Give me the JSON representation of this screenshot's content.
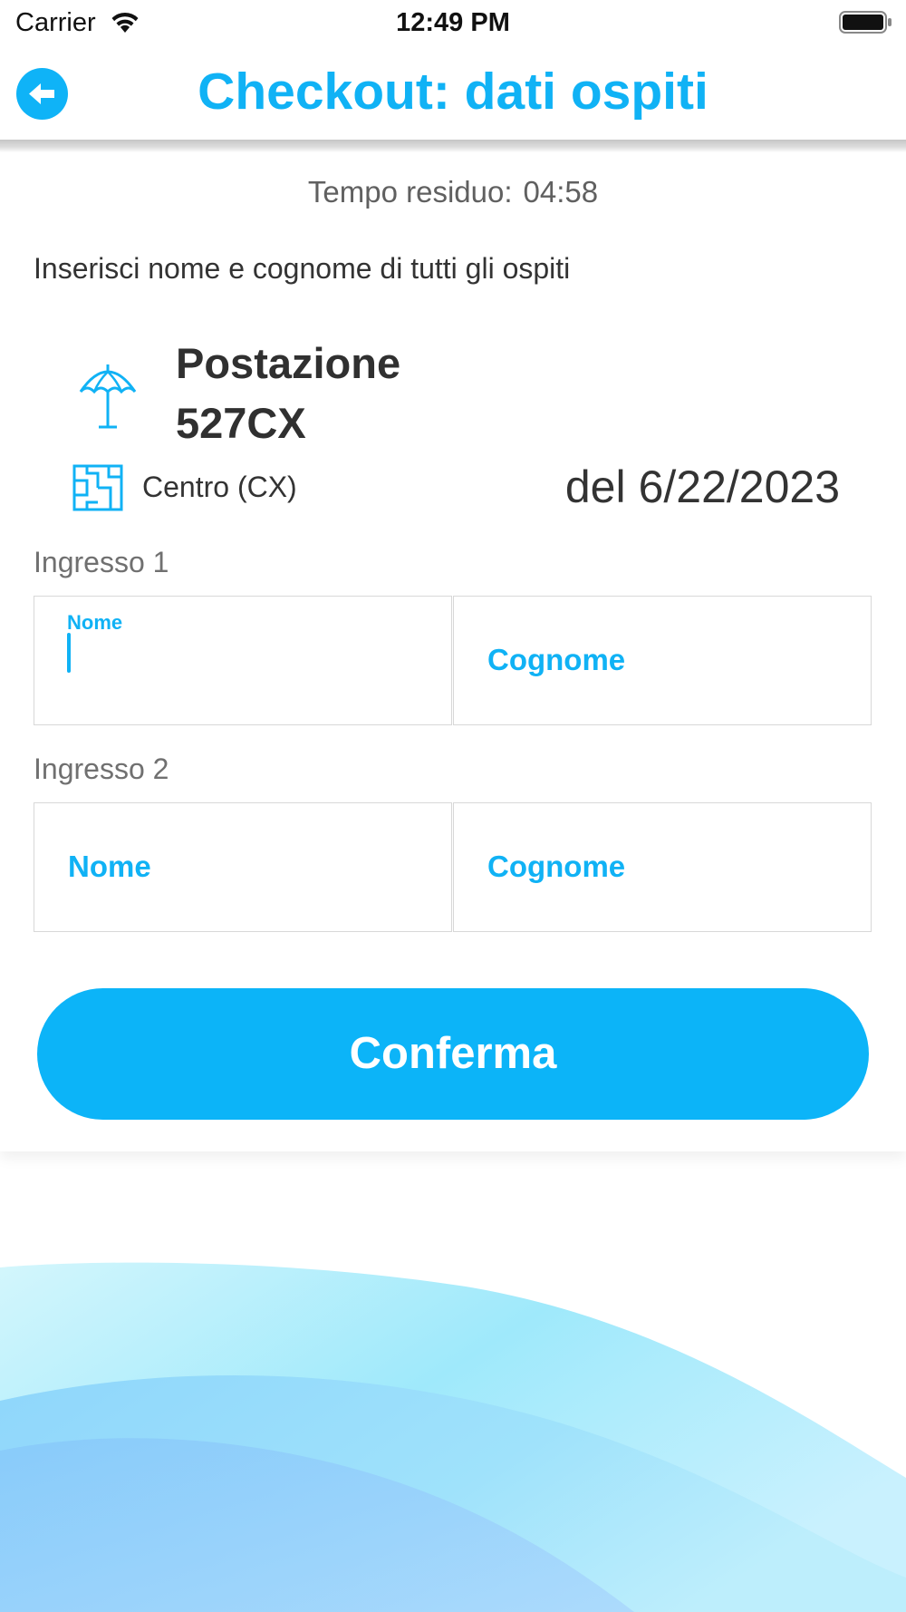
{
  "status_bar": {
    "carrier": "Carrier",
    "time": "12:49 PM"
  },
  "header": {
    "title": "Checkout: dati ospiti",
    "back_icon": "arrow-left-circle-icon"
  },
  "timer": {
    "label": "Tempo residuo:",
    "value": "04:58"
  },
  "instructions": "Inserisci nome e cognome di tutti gli ospiti",
  "station": {
    "title_line1": "Postazione",
    "title_line2": "527CX",
    "icon": "beach-umbrella-icon"
  },
  "zone": {
    "label": "Centro (CX)",
    "icon": "map-icon"
  },
  "date": {
    "prefix": "del",
    "value": "6/22/2023"
  },
  "entries": [
    {
      "label": "Ingresso 1",
      "first_name_placeholder": "Nome",
      "last_name_placeholder": "Cognome",
      "first_name_value": "",
      "last_name_value": ""
    },
    {
      "label": "Ingresso 2",
      "first_name_placeholder": "Nome",
      "last_name_placeholder": "Cognome",
      "first_name_value": "",
      "last_name_value": ""
    }
  ],
  "confirm_button": "Conferma",
  "colors": {
    "accent": "#10b2f5",
    "button": "#0cb4f8",
    "text": "#333333",
    "muted": "#707070"
  }
}
